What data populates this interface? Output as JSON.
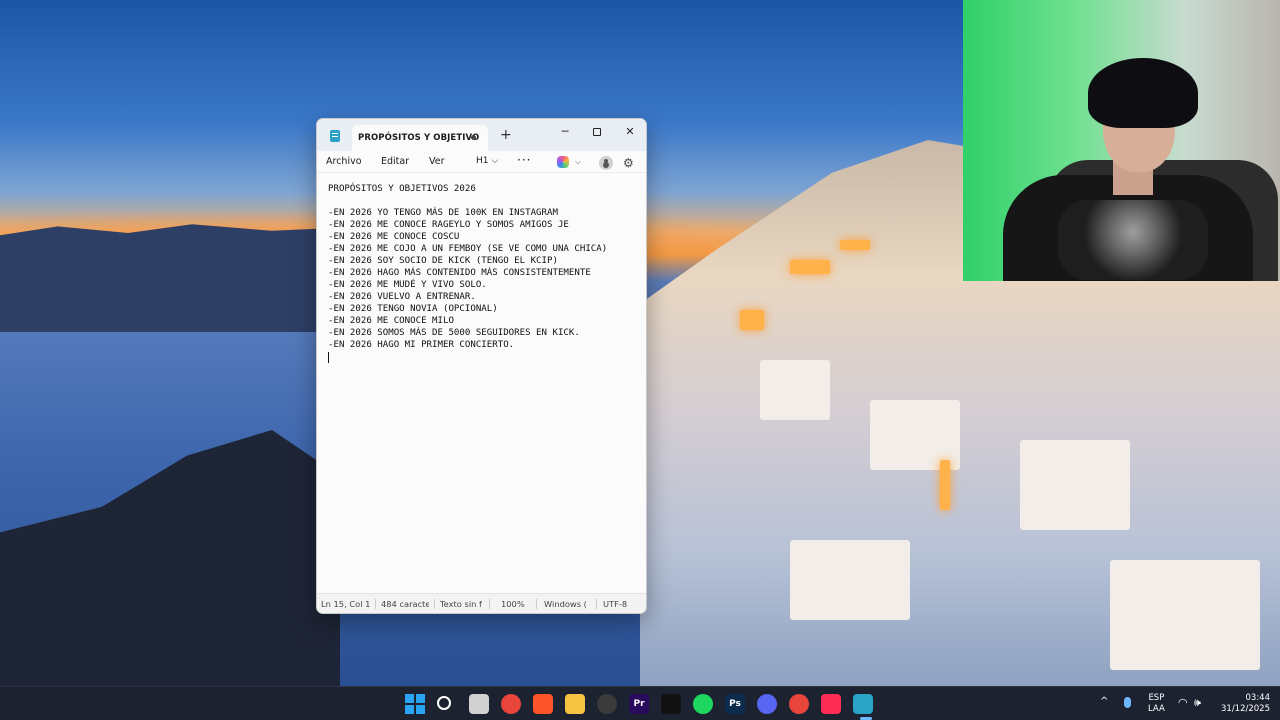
{
  "window": {
    "tab_title": "PROPÓSITOS Y OBJETIVO",
    "new_tab": "+",
    "minimize": "─",
    "close": "✕"
  },
  "menu": {
    "file": "Archivo",
    "edit": "Editar",
    "view": "Ver",
    "heading": "H1 ⌵",
    "more": "···",
    "copilot_chevron": "⌵",
    "settings": "⚙"
  },
  "editor": {
    "lines": [
      "PROPÓSITOS Y OBJETIVOS 2026",
      "",
      "-EN 2026 YO TENGO MÁS DE 100K EN INSTAGRAM",
      "-EN 2026 ME CONOCE RAGEYLO Y SOMOS AMIGOS JE",
      "-EN 2026 ME CONOCE COSCU",
      "-EN 2026 ME COJO A UN FEMBOY (SE VE COMO UNA CHICA)",
      "-EN 2026 SOY SOCIO DE KICK (TENGO EL KCIP)",
      "-EN 2026 HAGO MÁS CONTENIDO MÁS CONSISTENTEMENTE",
      "-EN 2026 ME MUDÉ Y VIVO SOLO.",
      "-EN 2026 VUELVO A ENTRENAR.",
      "-EN 2026 TENGO NOVIA (OPCIONAL)",
      "-EN 2026 ME CONOCE MILO",
      "-EN 2026 SOMOS MÁS DE 5000 SEGUIDORES EN KICK.",
      "-EN 2026 HAGO MI PRIMER CONCIERTO."
    ]
  },
  "status": {
    "position": "Ln 15, Col 1",
    "chars": "484 caracte",
    "format": "Texto sin f",
    "zoom": "100%",
    "line_endings": "Windows (",
    "encoding": "UTF-8"
  },
  "taskbar": {
    "apps": [
      {
        "name": "start-button",
        "label": "",
        "color": "#2aa3f2"
      },
      {
        "name": "search-button",
        "label": "",
        "color": "#ffffff"
      },
      {
        "name": "task-view-button",
        "label": "",
        "color": "#d0d0d0"
      },
      {
        "name": "chrome-app",
        "label": "",
        "color": "#e8453c"
      },
      {
        "name": "brave-app",
        "label": "",
        "color": "#fb542b"
      },
      {
        "name": "file-explorer-app",
        "label": "",
        "color": "#f5c242"
      },
      {
        "name": "obs-app",
        "label": "",
        "color": "#3b3b3b"
      },
      {
        "name": "premiere-app",
        "label": "Pr",
        "color": "#2a0a5c"
      },
      {
        "name": "capcut-app",
        "label": "",
        "color": "#111111"
      },
      {
        "name": "spotify-app",
        "label": "",
        "color": "#1ed760"
      },
      {
        "name": "photoshop-app",
        "label": "Ps",
        "color": "#0d2b4c"
      },
      {
        "name": "discord-app",
        "label": "",
        "color": "#5865f2"
      },
      {
        "name": "chrome-app-2",
        "label": "",
        "color": "#e8453c"
      },
      {
        "name": "tiktok-app",
        "label": "",
        "color": "#ff2d55"
      },
      {
        "name": "notepad-app",
        "label": "",
        "color": "#2aa3c7"
      }
    ],
    "tray": {
      "chevron": "^",
      "lang_top": "ESP",
      "lang_bottom": "LAA",
      "wifi": "◠",
      "volume": "🕪",
      "time": "03:44",
      "date": "31/12/2025"
    }
  }
}
